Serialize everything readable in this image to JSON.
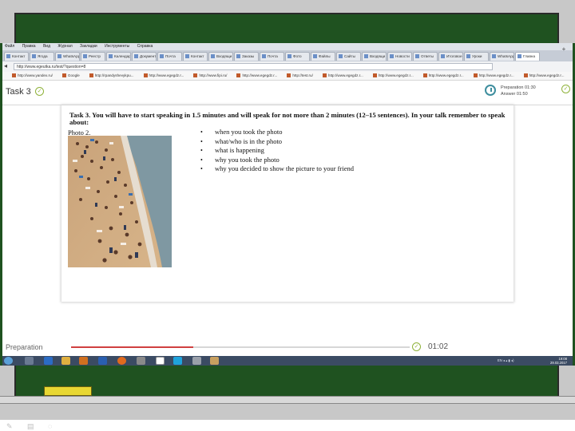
{
  "browser": {
    "menu": [
      "Файл",
      "Правка",
      "Вид",
      "Журнал",
      "Закладки",
      "Инструменты",
      "Справка"
    ],
    "tabs": [
      "Контакт",
      "Ягода",
      "WhatsApp",
      "Реестр",
      "Календар",
      "Документ",
      "Почта",
      "Контакт",
      "Входящи",
      "Заказы",
      "Почта",
      "Фото",
      "Файлы",
      "Сайты",
      "Входящи",
      "Новости",
      "Ответы",
      "Итоговое",
      "Уроки",
      "WhatsApp",
      "Главна"
    ],
    "active_tab_index": 20,
    "url": "http://www.egeutka.ru/test/?question=8",
    "bookmarks": [
      "http://www.yandex.ru/",
      "Google",
      "http://rpandyshevykpu...",
      "http://www.egegdz.r...",
      "http://www.fipi.ru/",
      "http://www.egegdz.r...",
      "http://test.ru/",
      "http://www.egegdz.r...",
      "http://www.egegdz.r...",
      "http://www.egegdz.r...",
      "http://www.egegdz.r...",
      "http://www.egegdz.r...",
      "http://www.egegdz.r..."
    ]
  },
  "app": {
    "task_title": "Task 3",
    "preparation_label": "Preparation 01:30",
    "answer_label": "Answer 01:50"
  },
  "task": {
    "instructions": "Task 3. You will have to start speaking in 1.5 minutes and will speak for not more than 2 minutes (12–15 sentences). In your talk remember to speak about:",
    "photo_label": "Photo 2.",
    "bullets": [
      "when you took the photo",
      "what/who is in the photo",
      "what is happening",
      "why you took the photo",
      "why you decided to show the picture to your friend"
    ]
  },
  "footer": {
    "label": "Preparation",
    "progress": 0.36,
    "time": "01:02"
  },
  "taskbar": {
    "tray_text": "EN  ◂  ▴  ▮  ◂)",
    "clock_time": "19:08",
    "clock_date": "29.03.2017"
  },
  "colors": {
    "board_green": "#1f5220",
    "chalk_yellow": "#e8d733",
    "progress_red": "#d04040",
    "accent_green": "#8fb23a",
    "timer_teal": "#3e8e9e",
    "taskbar": "#3b4b63"
  }
}
